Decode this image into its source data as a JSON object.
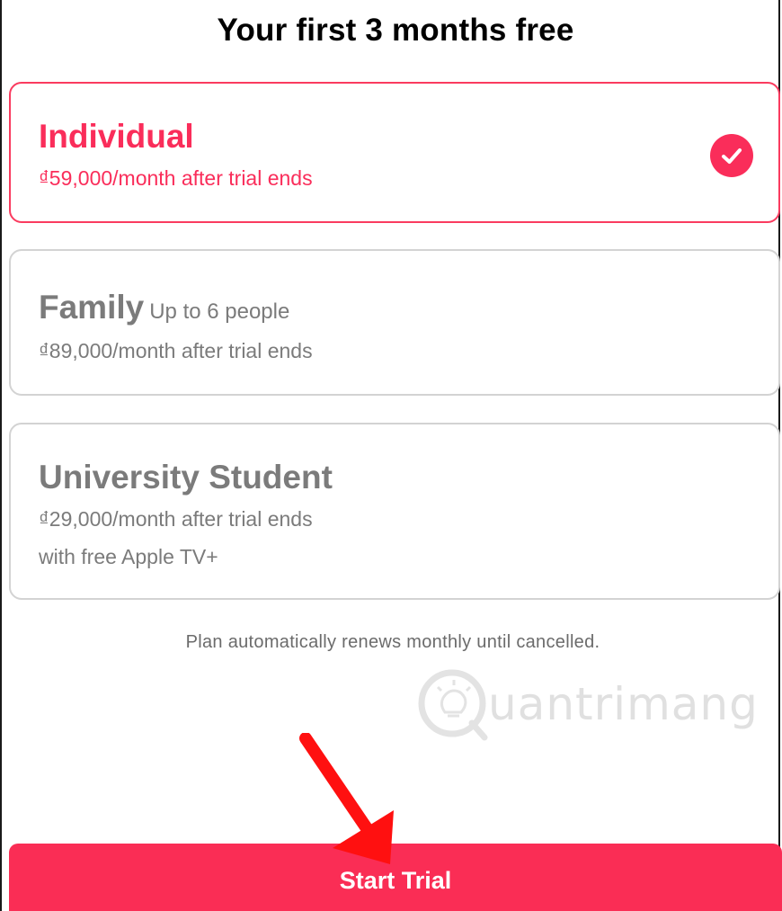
{
  "heading": "Your first 3 months free",
  "plans": [
    {
      "name": "Individual",
      "price": "₫59,000/month after trial ends",
      "selected": true,
      "check_icon": "checkmark-circle-icon"
    },
    {
      "name": "Family",
      "subtitle": "Up to 6 people",
      "price": "₫89,000/month after trial ends",
      "selected": false
    },
    {
      "name": "University Student",
      "price": "₫29,000/month after trial ends",
      "extra": "with free Apple TV+",
      "selected": false
    }
  ],
  "renew_note": "Plan automatically renews monthly until cancelled.",
  "watermark": {
    "text": "uantrimang",
    "icon": "lightbulb-q-logo"
  },
  "annotation_arrow": {
    "icon": "red-arrow-pointing-down",
    "color": "#ff0000"
  },
  "cta": {
    "label": "Start Trial"
  },
  "colors": {
    "accent": "#fa2d5a",
    "unselected_text": "#7b7b7b",
    "unselected_border": "#d3d3d3"
  }
}
